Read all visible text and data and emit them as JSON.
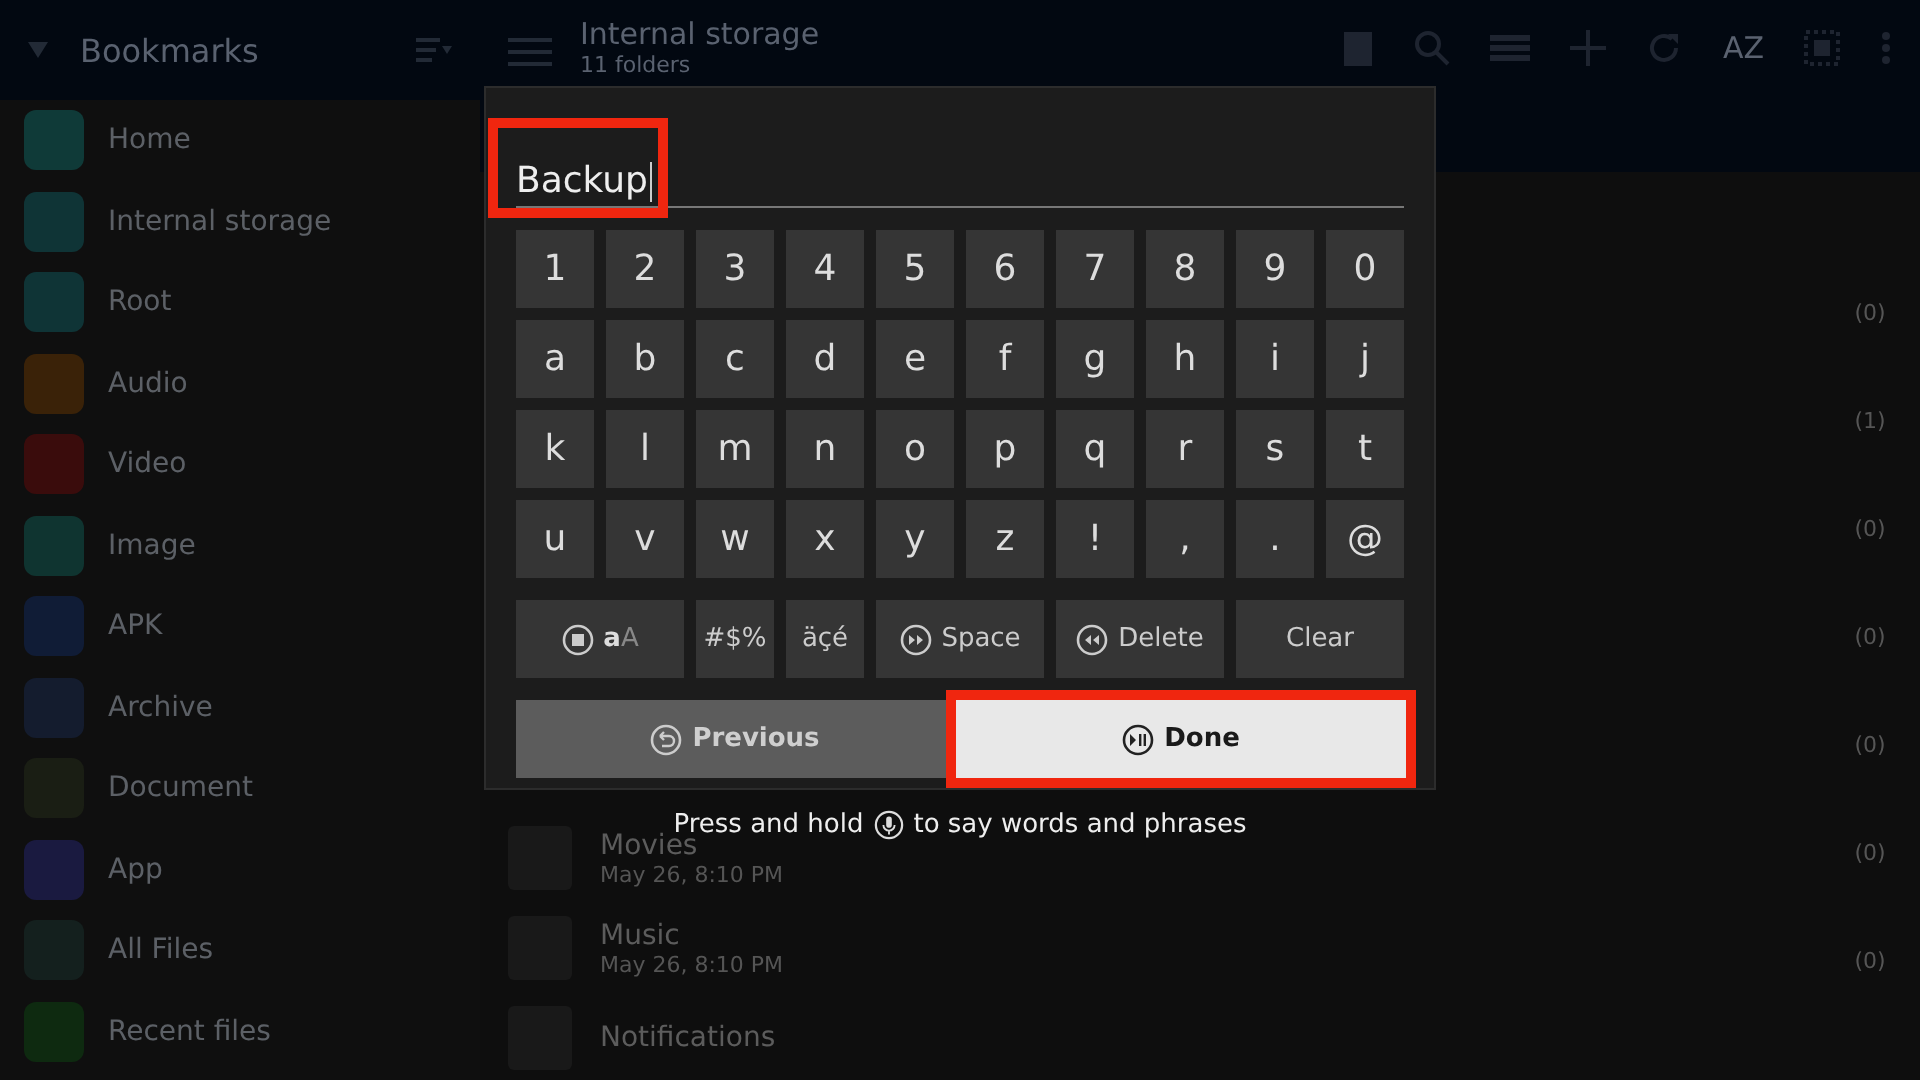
{
  "sidebar": {
    "title": "Bookmarks",
    "items": [
      {
        "label": "Home",
        "color": "#0f3a38"
      },
      {
        "label": "Internal storage",
        "color": "#0f3436"
      },
      {
        "label": "Root",
        "color": "#0f3436"
      },
      {
        "label": "Audio",
        "color": "#3a2208"
      },
      {
        "label": "Video",
        "color": "#3a0c0c"
      },
      {
        "label": "Image",
        "color": "#0f3430"
      },
      {
        "label": "APK",
        "color": "#101c36"
      },
      {
        "label": "Archive",
        "color": "#141c2e"
      },
      {
        "label": "Document",
        "color": "#1a1e14"
      },
      {
        "label": "App",
        "color": "#1a1a40"
      },
      {
        "label": "All Files",
        "color": "#14201e"
      },
      {
        "label": "Recent files",
        "color": "#0e2a10"
      }
    ]
  },
  "header": {
    "title": "Internal storage",
    "subtitle": "11 folders",
    "sort_label": "AZ"
  },
  "files": {
    "counts": [
      "(0)",
      "(1)",
      "(0)",
      "(0)",
      "(0)",
      "(0)",
      "(0)"
    ],
    "items": [
      {
        "name": "Movies",
        "date": "May 26, 8:10 PM"
      },
      {
        "name": "Music",
        "date": "May 26, 8:10 PM"
      },
      {
        "name": "Notifications"
      }
    ]
  },
  "keyboard": {
    "field": {
      "value": "Backup",
      "highlighted": true
    },
    "rows": [
      [
        "1",
        "2",
        "3",
        "4",
        "5",
        "6",
        "7",
        "8",
        "9",
        "0"
      ],
      [
        "a",
        "b",
        "c",
        "d",
        "e",
        "f",
        "g",
        "h",
        "i",
        "j"
      ],
      [
        "k",
        "l",
        "m",
        "n",
        "o",
        "p",
        "q",
        "r",
        "s",
        "t"
      ],
      [
        "u",
        "v",
        "w",
        "x",
        "y",
        "z",
        "!",
        ",",
        ".",
        "@"
      ]
    ],
    "special_keys": [
      {
        "kind": "case",
        "labels": [
          "a",
          "A"
        ]
      },
      {
        "kind": "symbols",
        "label": "#$%"
      },
      {
        "kind": "accents",
        "label": "äçé"
      },
      {
        "kind": "space",
        "label": "Space"
      },
      {
        "kind": "delete",
        "label": "Delete"
      },
      {
        "kind": "clear",
        "label": "Clear"
      }
    ],
    "actions": [
      {
        "kind": "previous",
        "label": "Previous",
        "highlighted": false
      },
      {
        "kind": "done",
        "label": "Done",
        "highlighted": true
      }
    ]
  },
  "hint": {
    "before": "Press and hold",
    "after": "to say words and phrases"
  }
}
